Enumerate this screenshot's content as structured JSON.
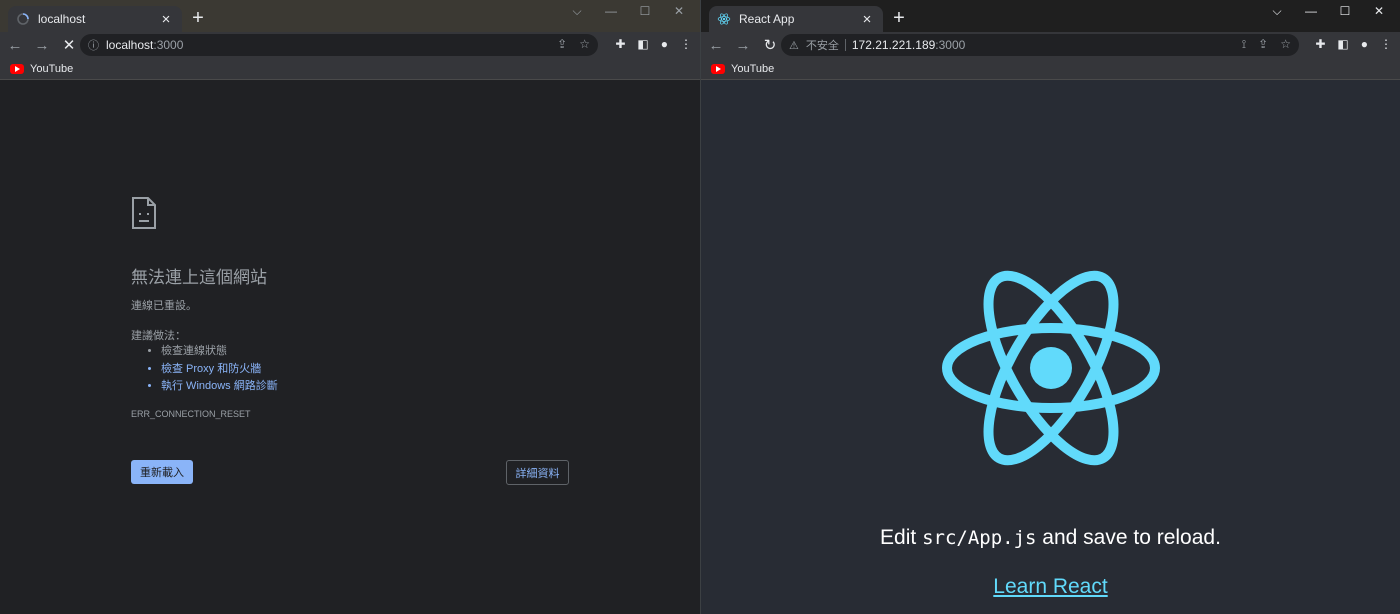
{
  "left": {
    "tab": {
      "title": "localhost"
    },
    "url": {
      "host": "localhost",
      "rest": ":3000"
    },
    "bookmark": {
      "label": "YouTube"
    },
    "error": {
      "title": "無法連上這個網站",
      "subtitle": "連線已重設。",
      "suggest_heading": "建議做法：",
      "suggestions": [
        "檢查連線狀態",
        "檢查 Proxy 和防火牆",
        "執行 Windows 網路診斷"
      ],
      "code": "ERR_CONNECTION_RESET",
      "reload_label": "重新載入",
      "details_label": "詳細資料"
    }
  },
  "right": {
    "tab": {
      "title": "React App"
    },
    "url": {
      "insecure": "不安全",
      "host": "172.21.221.189",
      "rest": ":3000"
    },
    "bookmark": {
      "label": "YouTube"
    },
    "app": {
      "edit_prefix": "Edit ",
      "edit_code": "src/App.js",
      "edit_suffix": " and save to reload.",
      "link_label": "Learn React"
    }
  },
  "colors": {
    "react_cyan": "#61dafb",
    "link_blue": "#8ab4f8",
    "react_bg": "#282c34",
    "error_bg": "#202124"
  }
}
